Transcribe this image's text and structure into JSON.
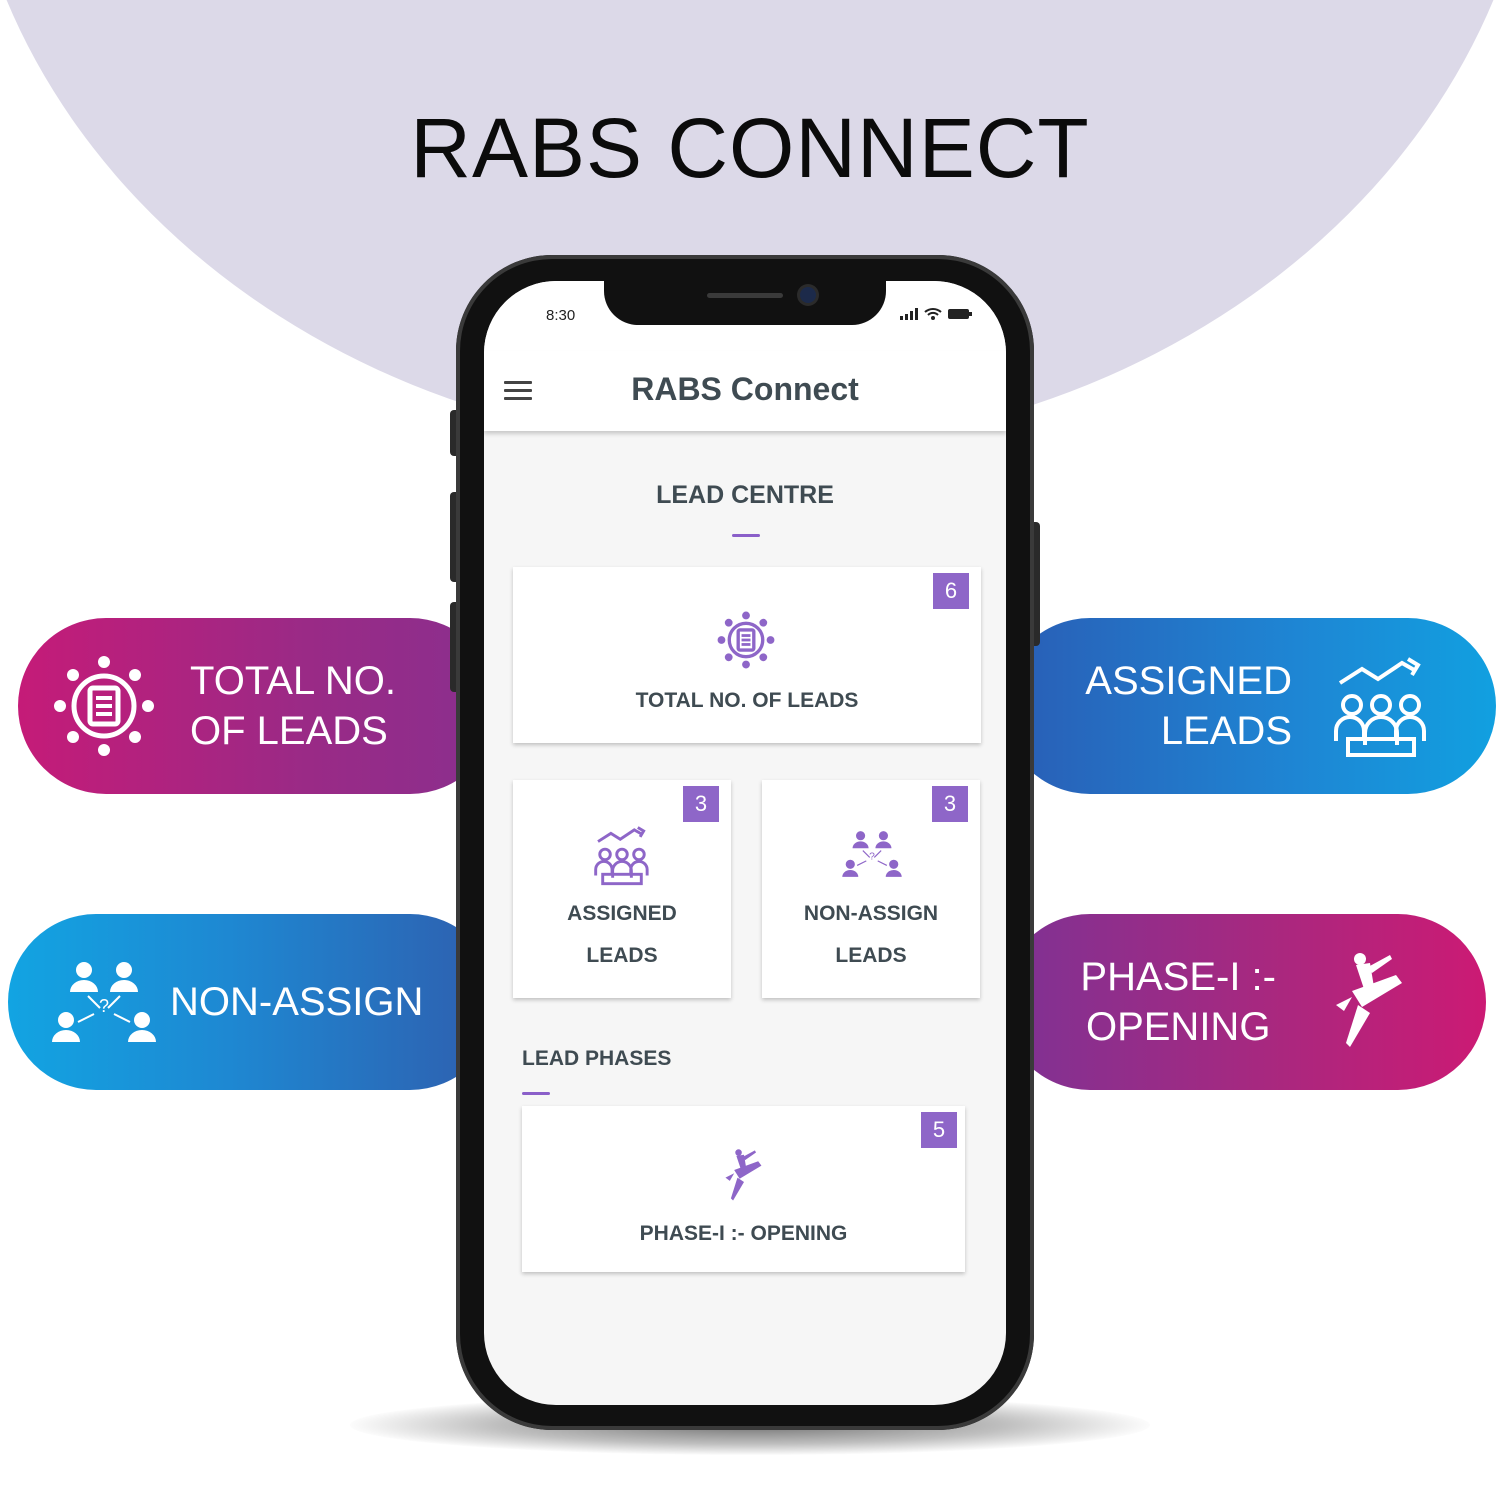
{
  "headline": "RABS CONNECT",
  "features": {
    "total": {
      "line1": "TOTAL NO.",
      "line2": "OF LEADS",
      "icon": "leads-network-icon"
    },
    "assigned": {
      "line1": "ASSIGNED",
      "line2": "LEADS",
      "icon": "team-growth-icon"
    },
    "non_assign": {
      "label": "NON-ASSIGN",
      "icon": "unassigned-people-icon"
    },
    "phase": {
      "line1": "PHASE-I :-",
      "line2": "OPENING",
      "icon": "rocket-rider-icon"
    }
  },
  "colors": {
    "magenta": "#c51b78",
    "blue": "#11a0e0",
    "purple": "#8e66c8",
    "text_dark": "#3f4b52"
  },
  "phone": {
    "status": {
      "time": "8:30",
      "icons": [
        "signal-icon",
        "wifi-icon",
        "battery-icon"
      ]
    },
    "app_title": "RABS Connect",
    "lead_centre": {
      "title": "LEAD CENTRE",
      "cards": {
        "total": {
          "label": "TOTAL NO. OF LEADS",
          "count": "6"
        },
        "assigned": {
          "line1": "ASSIGNED",
          "line2": "LEADS",
          "count": "3"
        },
        "non_assign": {
          "line1": "NON-ASSIGN",
          "line2": "LEADS",
          "count": "3"
        }
      }
    },
    "lead_phases": {
      "title": "LEAD PHASES",
      "cards": [
        {
          "label": "PHASE-I :- OPENING",
          "count": "5"
        }
      ]
    }
  }
}
